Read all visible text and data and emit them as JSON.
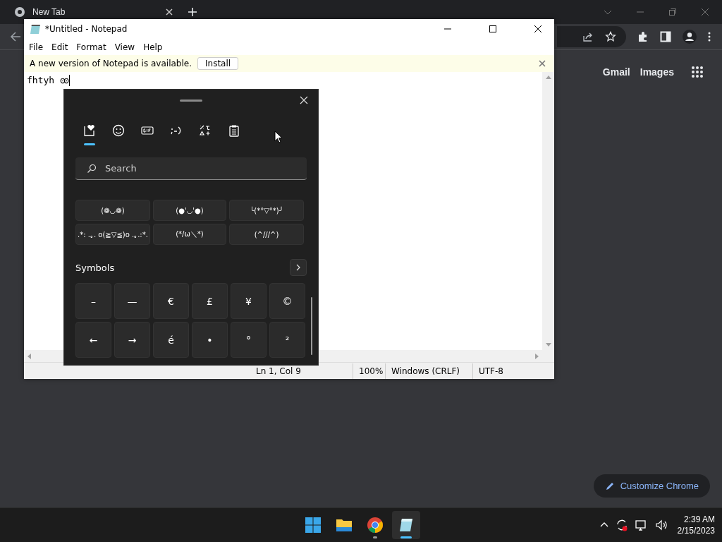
{
  "browser": {
    "tab": {
      "title": "New Tab"
    },
    "links": [
      "Gmail",
      "Images"
    ],
    "customize_button": "Customize Chrome"
  },
  "notepad": {
    "title": "*Untitled - Notepad",
    "menu": [
      "File",
      "Edit",
      "Format",
      "View",
      "Help"
    ],
    "notice": {
      "text": "A new version of Notepad is available.",
      "button": "Install"
    },
    "text": "fhtyh ꙭ",
    "status_bar": [
      "Ln 1, Col 9",
      "100%",
      "Windows (CRLF)",
      "UTF-8"
    ]
  },
  "emoji_panel": {
    "tabs": [
      {
        "kind": "favorites",
        "selected": true
      },
      {
        "kind": "emoji",
        "selected": false
      },
      {
        "kind": "gif",
        "selected": false
      },
      {
        "kind": "kaomoji",
        "selected": false
      },
      {
        "kind": "symbols",
        "selected": false
      },
      {
        "kind": "clipboard",
        "selected": false
      }
    ],
    "search": {
      "placeholder": "Search"
    },
    "kaomoji": [
      "(❁◡❁)",
      "(●'◡'●)",
      "╰(*°▽°*)╯",
      ".*: .｡. o(≧▽≦)o .｡.:*.",
      "(*/ω＼*)",
      "(^///^)"
    ],
    "section": "Symbols",
    "symbols": [
      "–",
      "—",
      "€",
      "£",
      "¥",
      "©",
      "←",
      "→",
      "é",
      "•",
      "°",
      "²"
    ]
  },
  "taskbar": {
    "apps": [
      {
        "kind": "start",
        "running": false,
        "active": false
      },
      {
        "kind": "explorer",
        "running": false,
        "active": false
      },
      {
        "kind": "chrome",
        "running": true,
        "active": false
      },
      {
        "kind": "notepad",
        "running": true,
        "active": true
      }
    ],
    "time": "2:39 AM",
    "date": "2/15/2023"
  }
}
